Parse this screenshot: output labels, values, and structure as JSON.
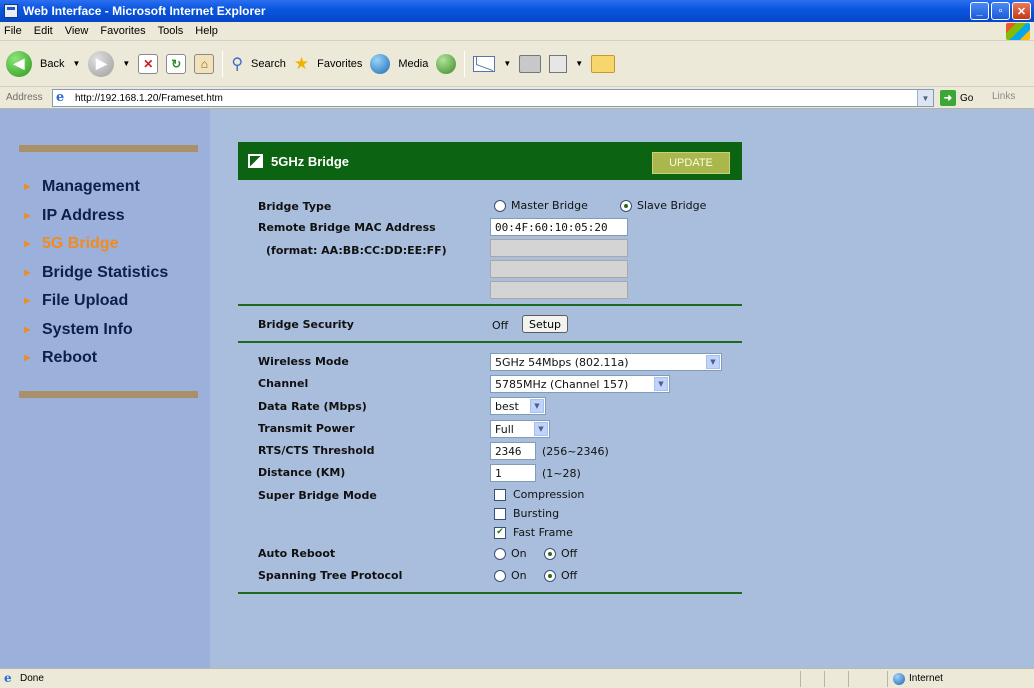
{
  "window": {
    "title": "Web Interface - Microsoft Internet Explorer"
  },
  "menu": [
    "File",
    "Edit",
    "View",
    "Favorites",
    "Tools",
    "Help"
  ],
  "toolbar": {
    "back": "Back",
    "search": "Search",
    "favorites": "Favorites",
    "media": "Media"
  },
  "address": {
    "label": "Address",
    "url": "http://192.168.1.20/Frameset.htm",
    "go": "Go",
    "links": "Links"
  },
  "sidebar": {
    "items": [
      {
        "label": "Management"
      },
      {
        "label": "IP Address"
      },
      {
        "label": "5G Bridge",
        "active": true
      },
      {
        "label": "Bridge Statistics"
      },
      {
        "label": "File Upload"
      },
      {
        "label": "System Info"
      },
      {
        "label": "Reboot"
      }
    ]
  },
  "panel": {
    "title": "5GHz Bridge",
    "update": "UPDATE",
    "bridge_type": {
      "label": "Bridge Type",
      "option_master": "Master Bridge",
      "option_slave": "Slave Bridge",
      "selected": "Slave Bridge"
    },
    "remote_mac": {
      "label": "Remote Bridge MAC Address",
      "format": "(format: AA:BB:CC:DD:EE:FF)",
      "value1": "00:4F:60:10:05:20",
      "value2": "",
      "value3": "",
      "value4": ""
    },
    "security": {
      "label": "Bridge Security",
      "value": "Off",
      "setup": "Setup"
    },
    "wireless_mode": {
      "label": "Wireless Mode",
      "value": "5GHz 54Mbps (802.11a)"
    },
    "channel": {
      "label": "Channel",
      "value": "5785MHz (Channel 157)"
    },
    "data_rate": {
      "label": "Data Rate (Mbps)",
      "value": "best"
    },
    "transmit_power": {
      "label": "Transmit Power",
      "value": "Full"
    },
    "rts": {
      "label": "RTS/CTS Threshold",
      "value": "2346",
      "range": "(256~2346)"
    },
    "distance": {
      "label": "Distance (KM)",
      "value": "1",
      "range": "(1~28)"
    },
    "super_bridge": {
      "label": "Super Bridge Mode",
      "compression": "Compression",
      "bursting": "Bursting",
      "fast_frame": "Fast Frame",
      "compression_checked": false,
      "bursting_checked": false,
      "fast_frame_checked": true
    },
    "auto_reboot": {
      "label": "Auto Reboot",
      "on": "On",
      "off": "Off",
      "selected": "Off"
    },
    "stp": {
      "label": "Spanning Tree Protocol",
      "on": "On",
      "off": "Off",
      "selected": "Off"
    }
  },
  "status": {
    "text": "Done",
    "zone": "Internet"
  }
}
